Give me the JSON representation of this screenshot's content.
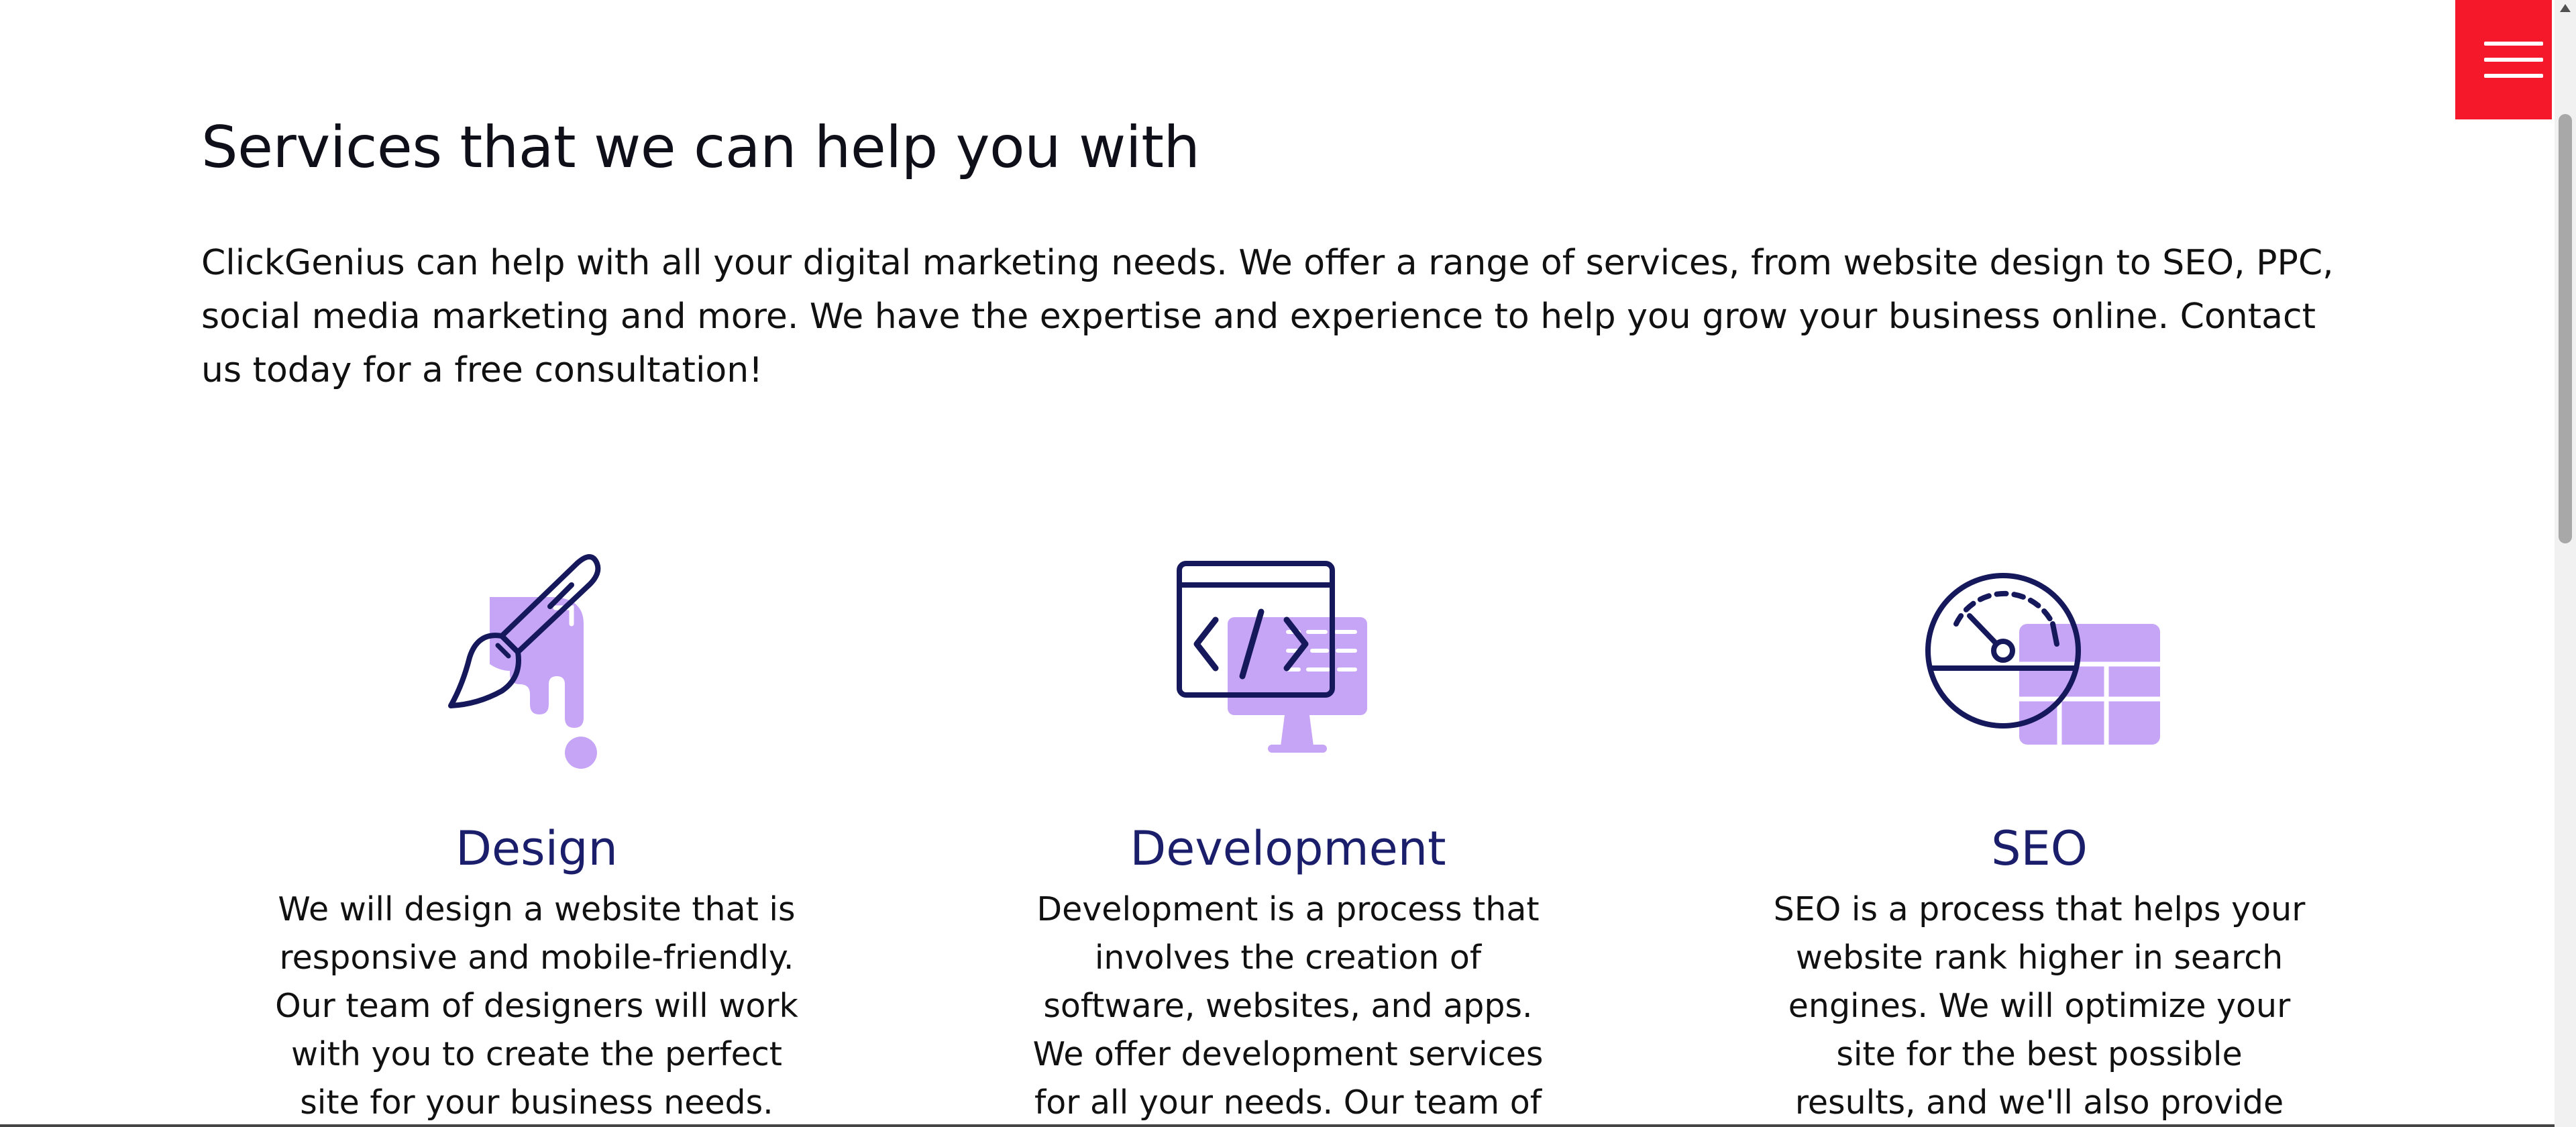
{
  "header": {
    "menu_icon": "hamburger-menu-icon",
    "menu_color": "#f5182b"
  },
  "section": {
    "title": "Services that we can help you with",
    "intro": "ClickGenius can help with all your digital marketing needs. We offer a range of services, from website design to SEO, PPC, social media marketing and more. We have the expertise and experience to help you grow your business online. Contact us today for a free consultation!"
  },
  "colors": {
    "accent_purple": "#c6a5f7",
    "icon_navy": "#16185c",
    "heading_navy": "#1b1e6b"
  },
  "services": [
    {
      "icon": "paintbrush-icon",
      "name": "Design",
      "description": "We will design a website that is responsive and mobile-friendly. Our team of designers will work with you to create the perfect site for your business needs. You can"
    },
    {
      "icon": "code-monitor-icon",
      "name": "Development",
      "description": "Development is a process that involves the creation of software, websites, and apps. We offer development services for all your needs. Our team of experts will"
    },
    {
      "icon": "speedometer-icon",
      "name": "SEO",
      "description": "SEO is a process that helps your website rank higher in search engines. We will optimize your site for the best possible results, and we'll also provide you with"
    }
  ]
}
